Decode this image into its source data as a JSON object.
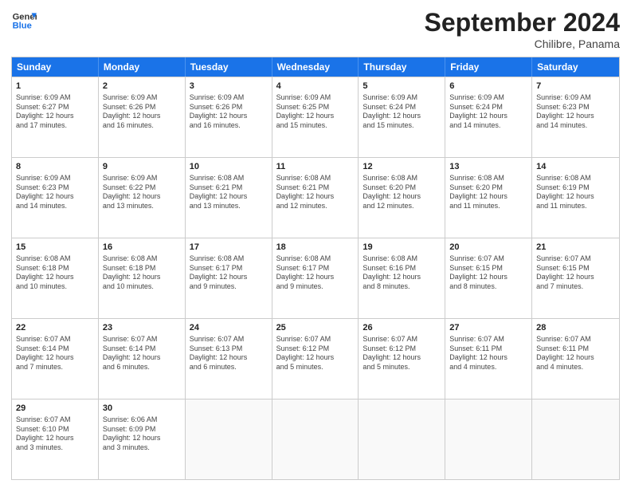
{
  "header": {
    "logo_general": "General",
    "logo_blue": "Blue",
    "month_title": "September 2024",
    "subtitle": "Chilibre, Panama"
  },
  "weekdays": [
    "Sunday",
    "Monday",
    "Tuesday",
    "Wednesday",
    "Thursday",
    "Friday",
    "Saturday"
  ],
  "weeks": [
    [
      {
        "day": "1",
        "info": "Sunrise: 6:09 AM\nSunset: 6:27 PM\nDaylight: 12 hours\nand 17 minutes."
      },
      {
        "day": "2",
        "info": "Sunrise: 6:09 AM\nSunset: 6:26 PM\nDaylight: 12 hours\nand 16 minutes."
      },
      {
        "day": "3",
        "info": "Sunrise: 6:09 AM\nSunset: 6:26 PM\nDaylight: 12 hours\nand 16 minutes."
      },
      {
        "day": "4",
        "info": "Sunrise: 6:09 AM\nSunset: 6:25 PM\nDaylight: 12 hours\nand 15 minutes."
      },
      {
        "day": "5",
        "info": "Sunrise: 6:09 AM\nSunset: 6:24 PM\nDaylight: 12 hours\nand 15 minutes."
      },
      {
        "day": "6",
        "info": "Sunrise: 6:09 AM\nSunset: 6:24 PM\nDaylight: 12 hours\nand 14 minutes."
      },
      {
        "day": "7",
        "info": "Sunrise: 6:09 AM\nSunset: 6:23 PM\nDaylight: 12 hours\nand 14 minutes."
      }
    ],
    [
      {
        "day": "8",
        "info": "Sunrise: 6:09 AM\nSunset: 6:23 PM\nDaylight: 12 hours\nand 14 minutes."
      },
      {
        "day": "9",
        "info": "Sunrise: 6:09 AM\nSunset: 6:22 PM\nDaylight: 12 hours\nand 13 minutes."
      },
      {
        "day": "10",
        "info": "Sunrise: 6:08 AM\nSunset: 6:21 PM\nDaylight: 12 hours\nand 13 minutes."
      },
      {
        "day": "11",
        "info": "Sunrise: 6:08 AM\nSunset: 6:21 PM\nDaylight: 12 hours\nand 12 minutes."
      },
      {
        "day": "12",
        "info": "Sunrise: 6:08 AM\nSunset: 6:20 PM\nDaylight: 12 hours\nand 12 minutes."
      },
      {
        "day": "13",
        "info": "Sunrise: 6:08 AM\nSunset: 6:20 PM\nDaylight: 12 hours\nand 11 minutes."
      },
      {
        "day": "14",
        "info": "Sunrise: 6:08 AM\nSunset: 6:19 PM\nDaylight: 12 hours\nand 11 minutes."
      }
    ],
    [
      {
        "day": "15",
        "info": "Sunrise: 6:08 AM\nSunset: 6:18 PM\nDaylight: 12 hours\nand 10 minutes."
      },
      {
        "day": "16",
        "info": "Sunrise: 6:08 AM\nSunset: 6:18 PM\nDaylight: 12 hours\nand 10 minutes."
      },
      {
        "day": "17",
        "info": "Sunrise: 6:08 AM\nSunset: 6:17 PM\nDaylight: 12 hours\nand 9 minutes."
      },
      {
        "day": "18",
        "info": "Sunrise: 6:08 AM\nSunset: 6:17 PM\nDaylight: 12 hours\nand 9 minutes."
      },
      {
        "day": "19",
        "info": "Sunrise: 6:08 AM\nSunset: 6:16 PM\nDaylight: 12 hours\nand 8 minutes."
      },
      {
        "day": "20",
        "info": "Sunrise: 6:07 AM\nSunset: 6:15 PM\nDaylight: 12 hours\nand 8 minutes."
      },
      {
        "day": "21",
        "info": "Sunrise: 6:07 AM\nSunset: 6:15 PM\nDaylight: 12 hours\nand 7 minutes."
      }
    ],
    [
      {
        "day": "22",
        "info": "Sunrise: 6:07 AM\nSunset: 6:14 PM\nDaylight: 12 hours\nand 7 minutes."
      },
      {
        "day": "23",
        "info": "Sunrise: 6:07 AM\nSunset: 6:14 PM\nDaylight: 12 hours\nand 6 minutes."
      },
      {
        "day": "24",
        "info": "Sunrise: 6:07 AM\nSunset: 6:13 PM\nDaylight: 12 hours\nand 6 minutes."
      },
      {
        "day": "25",
        "info": "Sunrise: 6:07 AM\nSunset: 6:12 PM\nDaylight: 12 hours\nand 5 minutes."
      },
      {
        "day": "26",
        "info": "Sunrise: 6:07 AM\nSunset: 6:12 PM\nDaylight: 12 hours\nand 5 minutes."
      },
      {
        "day": "27",
        "info": "Sunrise: 6:07 AM\nSunset: 6:11 PM\nDaylight: 12 hours\nand 4 minutes."
      },
      {
        "day": "28",
        "info": "Sunrise: 6:07 AM\nSunset: 6:11 PM\nDaylight: 12 hours\nand 4 minutes."
      }
    ],
    [
      {
        "day": "29",
        "info": "Sunrise: 6:07 AM\nSunset: 6:10 PM\nDaylight: 12 hours\nand 3 minutes."
      },
      {
        "day": "30",
        "info": "Sunrise: 6:06 AM\nSunset: 6:09 PM\nDaylight: 12 hours\nand 3 minutes."
      },
      {
        "day": "",
        "info": ""
      },
      {
        "day": "",
        "info": ""
      },
      {
        "day": "",
        "info": ""
      },
      {
        "day": "",
        "info": ""
      },
      {
        "day": "",
        "info": ""
      }
    ]
  ]
}
